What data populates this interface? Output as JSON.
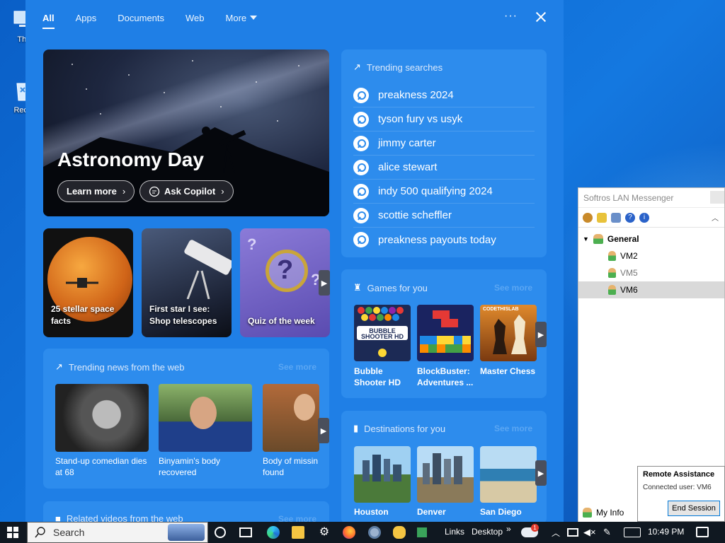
{
  "desktop": {
    "icons": [
      {
        "label": "Thi",
        "icon": "this-pc-icon"
      },
      {
        "label": "Recy",
        "icon": "recycle-bin-icon"
      }
    ]
  },
  "search_panel": {
    "tabs": [
      {
        "label": "All",
        "active": true
      },
      {
        "label": "Apps"
      },
      {
        "label": "Documents"
      },
      {
        "label": "Web"
      },
      {
        "label": "More"
      }
    ],
    "more_options_glyph": "···",
    "hero": {
      "title": "Astronomy Day",
      "learn_more": "Learn more",
      "ask_copilot": "Ask Copilot"
    },
    "tiles": [
      {
        "caption": "25 stellar space facts"
      },
      {
        "caption": "First star I see: Shop telescopes"
      },
      {
        "caption": "Quiz of the week"
      }
    ],
    "trending_searches": {
      "title": "Trending searches",
      "items": [
        "preakness 2024",
        "tyson fury vs usyk",
        "jimmy carter",
        "alice stewart",
        "indy 500 qualifying 2024",
        "scottie scheffler",
        "preakness payouts today"
      ]
    },
    "games": {
      "title": "Games for you",
      "see_more": "See more",
      "items": [
        {
          "name": "Bubble Shooter HD",
          "art_text": "BUBBLE SHOOTER HD"
        },
        {
          "name": "BlockBuster: Adventures ...",
          "art_text": ""
        },
        {
          "name": "Master Chess",
          "art_text": "CODETHISLAB"
        }
      ]
    },
    "news": {
      "title": "Trending news from the web",
      "see_more": "See more",
      "items": [
        {
          "caption": "Stand-up comedian dies at 68"
        },
        {
          "caption": "Binyamin's body recovered"
        },
        {
          "caption": "Body of missin found"
        }
      ]
    },
    "destinations": {
      "title": "Destinations for you",
      "see_more": "See more",
      "items": [
        "Houston",
        "Denver",
        "San Diego"
      ]
    },
    "videos": {
      "title": "Related videos from the web",
      "see_more": "See more"
    }
  },
  "messenger": {
    "title": "Softros LAN Messenger",
    "group": "General",
    "users": [
      {
        "name": "VM2",
        "selected": false,
        "dim": false
      },
      {
        "name": "VM5",
        "selected": false,
        "dim": true
      },
      {
        "name": "VM6",
        "selected": true,
        "dim": false
      }
    ],
    "my_info": "My Info"
  },
  "remote_assistance": {
    "title": "Remote Assistance",
    "connected": "Connected user:  VM6",
    "end_session": "End Session"
  },
  "taskbar": {
    "search_label": "Search",
    "links": "Links",
    "desktop": "Desktop",
    "chevron": "»",
    "weather_badge": "1",
    "time": "10:49 PM"
  }
}
